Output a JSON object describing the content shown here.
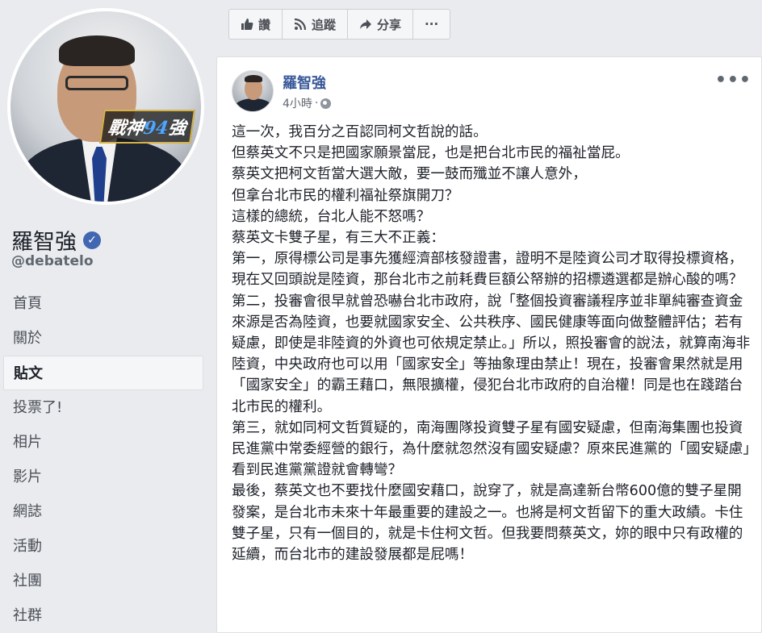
{
  "profile": {
    "name": "羅智強",
    "handle": "@debatelo",
    "badge_text_prefix": "戰神",
    "badge_text_num": "94",
    "badge_text_suffix": "強"
  },
  "nav": {
    "items": [
      {
        "label": "首頁",
        "active": false
      },
      {
        "label": "關於",
        "active": false
      },
      {
        "label": "貼文",
        "active": true
      },
      {
        "label": "投票了!",
        "active": false
      },
      {
        "label": "相片",
        "active": false
      },
      {
        "label": "影片",
        "active": false
      },
      {
        "label": "網誌",
        "active": false
      },
      {
        "label": "活動",
        "active": false
      },
      {
        "label": "社團",
        "active": false
      },
      {
        "label": "社群",
        "active": false
      }
    ]
  },
  "actions": {
    "like_label": "讚",
    "follow_label": "追蹤",
    "share_label": "分享",
    "more_label": "···"
  },
  "post": {
    "author": "羅智強",
    "time": "4小時",
    "menu": "•••",
    "lines": [
      "這一次，我百分之百認同柯文哲說的話。",
      "但蔡英文不只是把國家願景當屁，也是把台北市民的福祉當屁。",
      "蔡英文把柯文哲當大選大敵，要一鼓而殲並不讓人意外，",
      "但拿台北市民的權利福祉祭旗開刀？",
      "這樣的總統，台北人能不怒嗎？",
      "蔡英文卡雙子星，有三大不正義：",
      "第一，原得標公司是事先獲經濟部核發證書，證明不是陸資公司才取得投標資格，現在又回頭說是陸資，那台北市之前耗費巨額公帑辦的招標遴選都是辦心酸的嗎？",
      "第二，投審會很早就曾恐嚇台北市政府，說「整個投資審議程序並非單純審查資金來源是否為陸資，也要就國家安全、公共秩序、國民健康等面向做整體評估；若有疑慮，即使是非陸資的外資也可依規定禁止。」所以，照投審會的說法，就算南海非陸資，中央政府也可以用「國家安全」等抽象理由禁止！現在，投審會果然就是用「國家安全」的霸王藉口，無限擴權，侵犯台北市政府的自治權！同是也在踐踏台北市民的權利。",
      "第三，就如同柯文哲質疑的，南海團隊投資雙子星有國安疑慮，但南海集團也投資民進黨中常委經營的銀行，為什麼就忽然沒有國安疑慮？原來民進黨的「國安疑慮」看到民進黨黨證就會轉彎？",
      "最後，蔡英文也不要找什麼國安藉口，說穿了，就是高達新台幣600億的雙子星開發案，是台北市未來十年最重要的建設之一。也將是柯文哲留下的重大政績。卡住雙子星，只有一個目的，就是卡住柯文哲。但我要問蔡英文，妳的眼中只有政權的延續，而台北市的建設發展都是屁嗎！"
    ]
  },
  "colors": {
    "background": "#e9ebee",
    "link": "#385898",
    "verified": "#4267b2"
  }
}
